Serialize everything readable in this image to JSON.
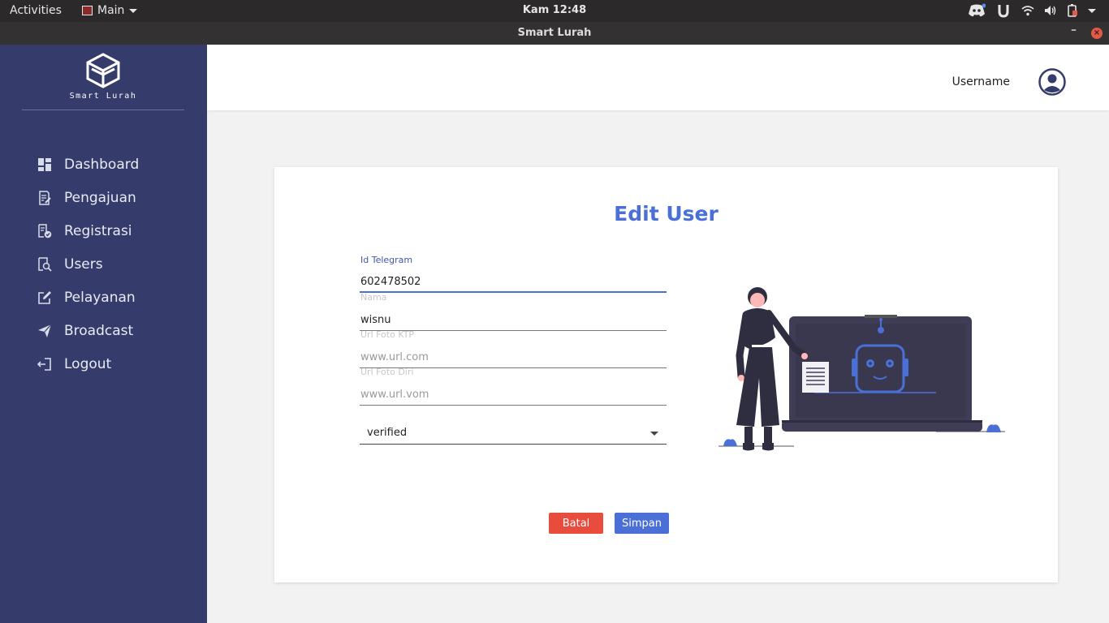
{
  "system_bar": {
    "activities": "Activities",
    "app_menu": "Main",
    "clock": "Kam 12:48"
  },
  "window": {
    "title": "Smart Lurah",
    "minimize": "–",
    "close": "×"
  },
  "sidebar": {
    "brand": "Smart Lurah",
    "items": [
      {
        "label": "Dashboard",
        "icon": "dashboard-icon"
      },
      {
        "label": "Pengajuan",
        "icon": "document-edit-icon"
      },
      {
        "label": "Registrasi",
        "icon": "document-check-icon"
      },
      {
        "label": "Users",
        "icon": "user-search-icon"
      },
      {
        "label": "Pelayanan",
        "icon": "edit-icon"
      },
      {
        "label": "Broadcast",
        "icon": "send-icon"
      },
      {
        "label": "Logout",
        "icon": "logout-icon"
      }
    ]
  },
  "header": {
    "username": "Username"
  },
  "form": {
    "title": "Edit User",
    "id_telegram": {
      "label": "Id Telegram",
      "value": "602478502"
    },
    "nama": {
      "label": "Nama",
      "value": "wisnu"
    },
    "url_foto_ktp": {
      "label": "Url Foto KTP",
      "placeholder": "www.url.com"
    },
    "url_foto_diri": {
      "label": "Url Foto Diri",
      "placeholder": "www.url.vom"
    },
    "status": {
      "value": "verified"
    },
    "cancel_label": "Batal",
    "save_label": "Simpan"
  },
  "colors": {
    "sidebar": "#353c6c",
    "accent": "#4a6fd6",
    "danger": "#e74c3c"
  }
}
